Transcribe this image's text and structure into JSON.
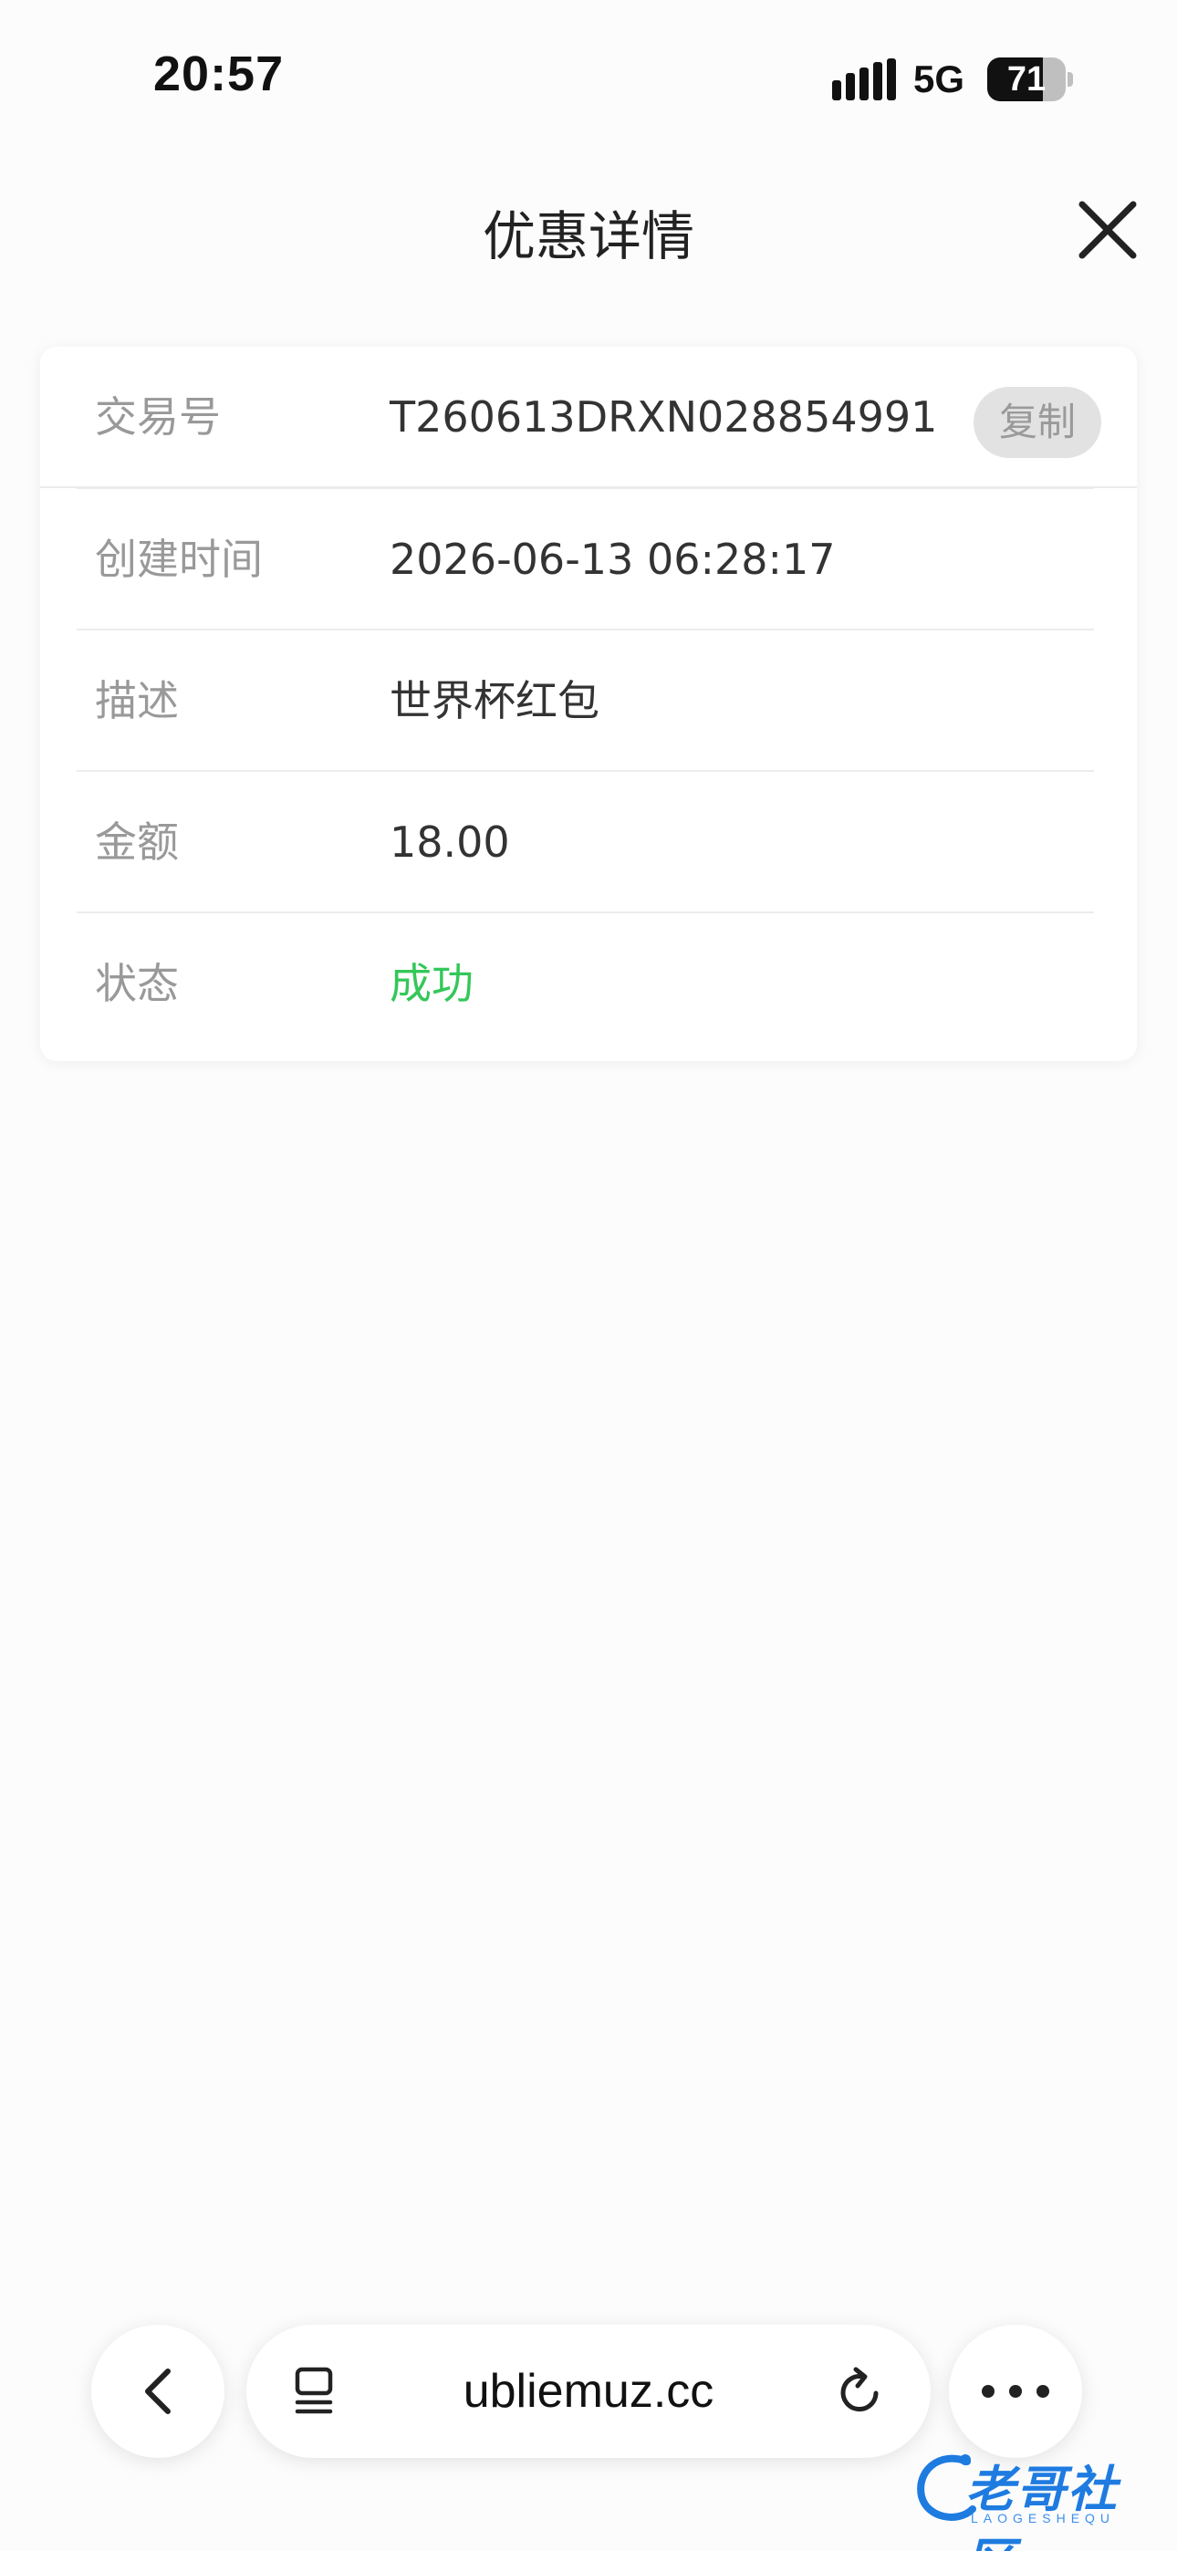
{
  "status_bar": {
    "time": "20:57",
    "network": "5G",
    "battery_level": "71",
    "battery_fraction": 0.71
  },
  "header": {
    "title": "优惠详情"
  },
  "details": {
    "copy_label": "复制",
    "rows": [
      {
        "label": "交易号",
        "value": "T260613DRXN028854991"
      },
      {
        "label": "创建时间",
        "value": "2026-06-13 06:28:17"
      },
      {
        "label": "描述",
        "value": "世界杯红包"
      },
      {
        "label": "金额",
        "value": "18.00"
      },
      {
        "label": "状态",
        "value": "成功"
      }
    ]
  },
  "browser_bar": {
    "url": "ubliemuz.cc"
  },
  "watermark": {
    "text": "老哥社区",
    "subtext": "LAOGESHEQU"
  },
  "colors": {
    "success": "#34c759",
    "label": "#999999",
    "watermark": "#1e7be0"
  }
}
